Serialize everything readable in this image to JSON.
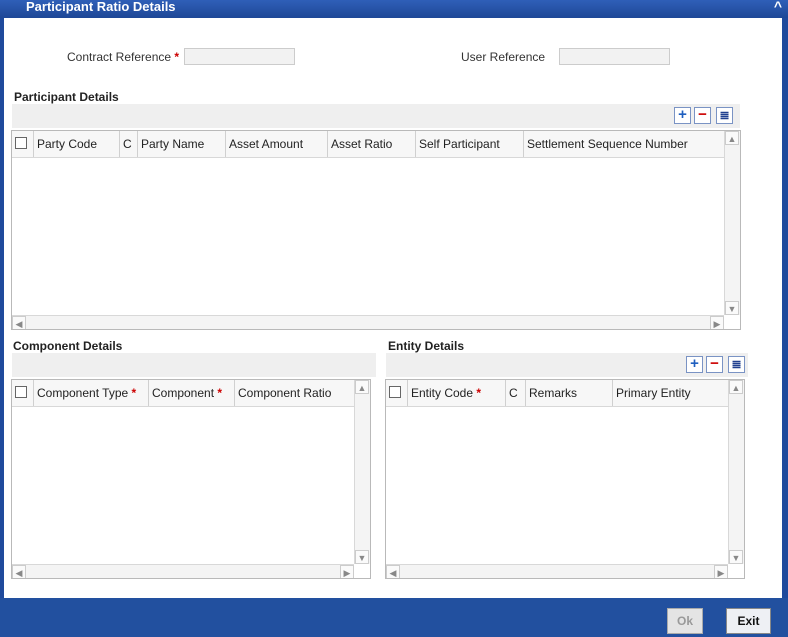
{
  "window": {
    "title": "Participant Ratio Details",
    "close_icon": "caret-up-icon"
  },
  "header": {
    "contract_reference_label": "Contract Reference",
    "contract_reference_value": "",
    "user_reference_label": "User Reference",
    "user_reference_value": "",
    "required_mark": "*"
  },
  "participant": {
    "title": "Participant Details",
    "columns": [
      "Party Code",
      "C",
      "Party Name",
      "Asset Amount",
      "Asset Ratio",
      "Self Participant",
      "Settlement Sequence Number"
    ],
    "rows": []
  },
  "component": {
    "title": "Component Details",
    "columns": [
      "Component Type",
      "Component",
      "Component Ratio"
    ],
    "rows": []
  },
  "entity": {
    "title": "Entity Details",
    "columns": [
      "Entity Code",
      "C",
      "Remarks",
      "Primary Entity"
    ],
    "rows": []
  },
  "toolbar": {
    "add": "+",
    "delete": "−",
    "single_view": "≣"
  },
  "footer": {
    "ok_label": "Ok",
    "exit_label": "Exit"
  },
  "colors": {
    "frame": "#1f4a9c",
    "required": "#cc0000"
  }
}
